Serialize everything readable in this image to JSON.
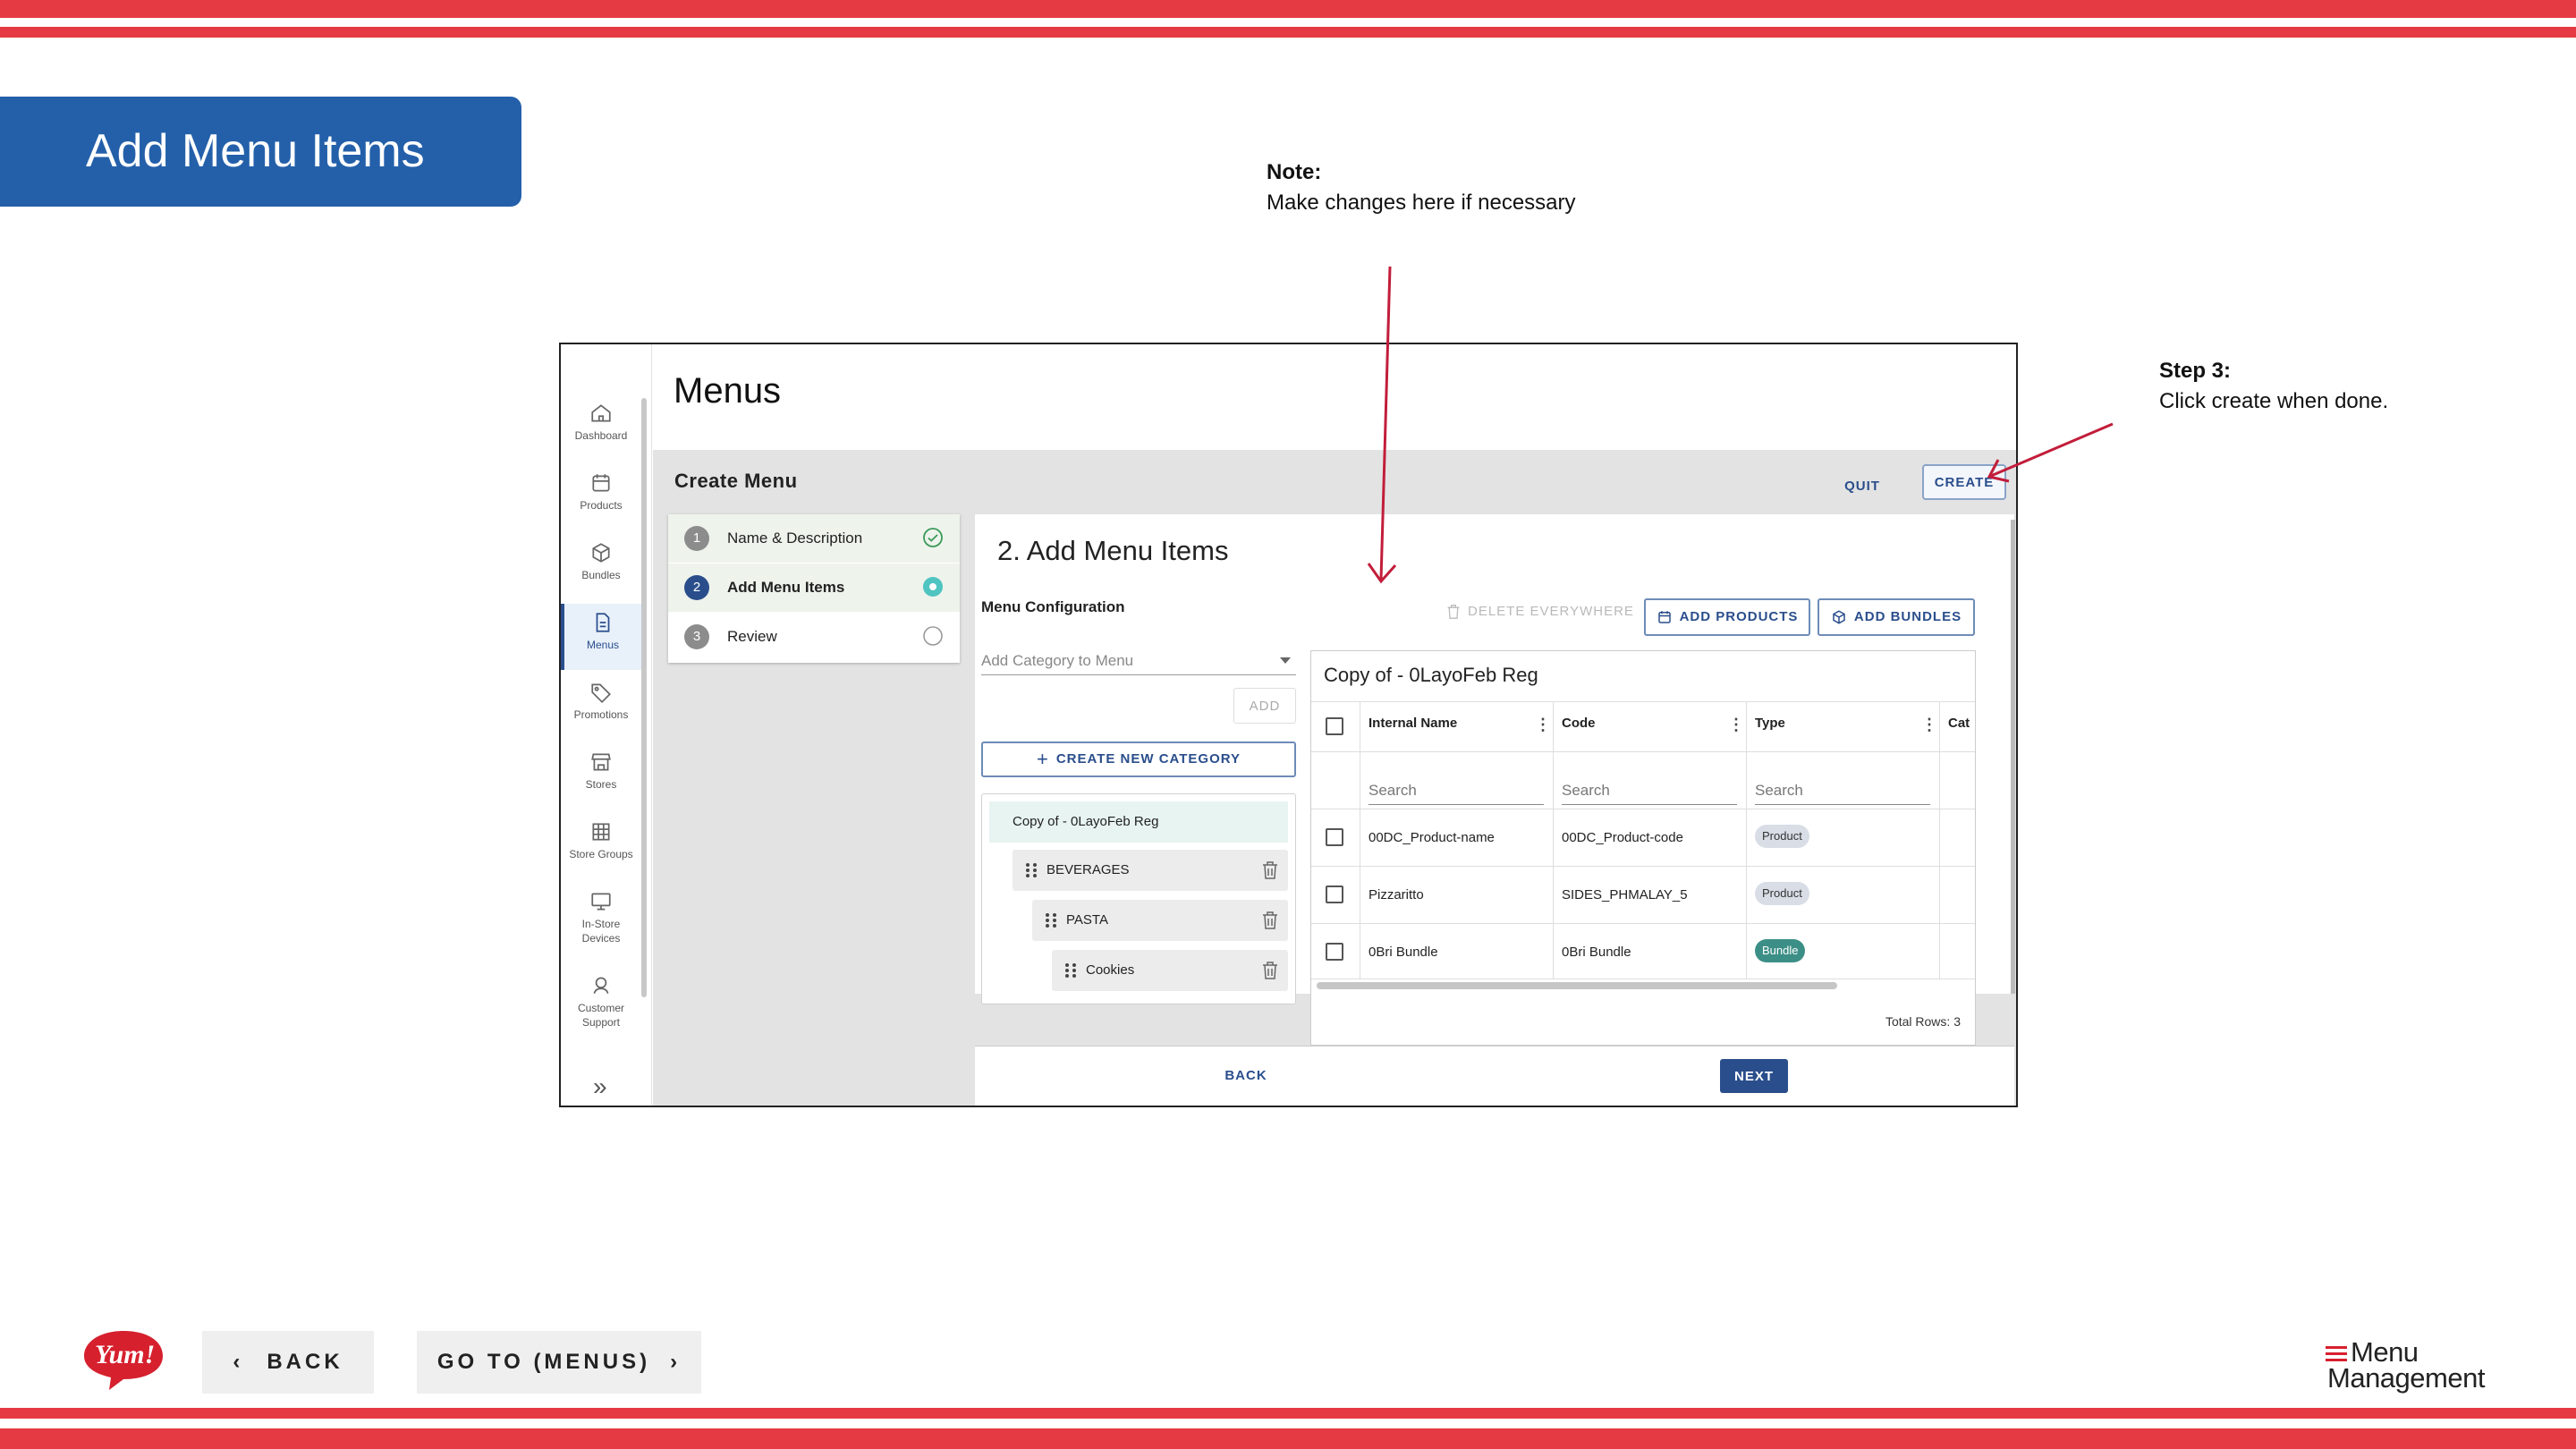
{
  "slide": {
    "title": "Add Menu Items",
    "note_heading": "Note:",
    "note_text": "Make changes here if necessary",
    "step_heading": "Step 3:",
    "step_text": "Click create when done.",
    "back_label": "BACK",
    "goto_label": "GO TO (MENUS)",
    "brand_logo_text": "Yum!",
    "product_logo_line1": "Menu",
    "product_logo_line2": "Management",
    "accent_color": "#e53a43",
    "banner_color": "#2460aa"
  },
  "app": {
    "page_title": "Menus",
    "sidebar": [
      {
        "label": "Dashboard",
        "icon": "home-icon"
      },
      {
        "label": "Products",
        "icon": "calendar-icon"
      },
      {
        "label": "Bundles",
        "icon": "box-icon"
      },
      {
        "label": "Menus",
        "icon": "document-icon",
        "active": true
      },
      {
        "label": "Promotions",
        "icon": "tag-icon"
      },
      {
        "label": "Stores",
        "icon": "store-icon"
      },
      {
        "label": "Store Groups",
        "icon": "grid-icon"
      },
      {
        "label": "In-Store Devices",
        "icon": "monitor-icon"
      },
      {
        "label": "Customer Support",
        "icon": "headset-icon"
      }
    ],
    "create_menu": {
      "title": "Create Menu",
      "quit_label": "QUIT",
      "create_label": "CREATE",
      "steps": [
        {
          "num": "1",
          "label": "Name & Description",
          "state": "done"
        },
        {
          "num": "2",
          "label": "Add Menu Items",
          "state": "current"
        },
        {
          "num": "3",
          "label": "Review",
          "state": "pending"
        }
      ],
      "section_title": "2. Add Menu Items",
      "menu_config_label": "Menu Configuration",
      "add_category_placeholder": "Add Category to Menu",
      "add_label": "ADD",
      "create_category_label": "CREATE NEW CATEGORY",
      "tree": {
        "root": "Copy of - 0LayoFeb Reg",
        "items": [
          "BEVERAGES",
          "PASTA",
          "Cookies"
        ]
      },
      "delete_everywhere_label": "DELETE EVERYWHERE",
      "add_products_label": "ADD PRODUCTS",
      "add_bundles_label": "ADD BUNDLES",
      "grid": {
        "title": "Copy of - 0LayoFeb Reg",
        "columns": [
          "Internal Name",
          "Code",
          "Type",
          "Cat"
        ],
        "search_placeholder": "Search",
        "rows": [
          {
            "name": "00DC_Product-name",
            "code": "00DC_Product-code",
            "type": "Product"
          },
          {
            "name": "Pizzaritto",
            "code": "SIDES_PHMALAY_5",
            "type": "Product"
          },
          {
            "name": "0Bri Bundle",
            "code": "0Bri Bundle",
            "type": "Bundle"
          }
        ],
        "total_rows": "Total Rows: 3"
      },
      "back_label": "BACK",
      "next_label": "NEXT"
    }
  }
}
